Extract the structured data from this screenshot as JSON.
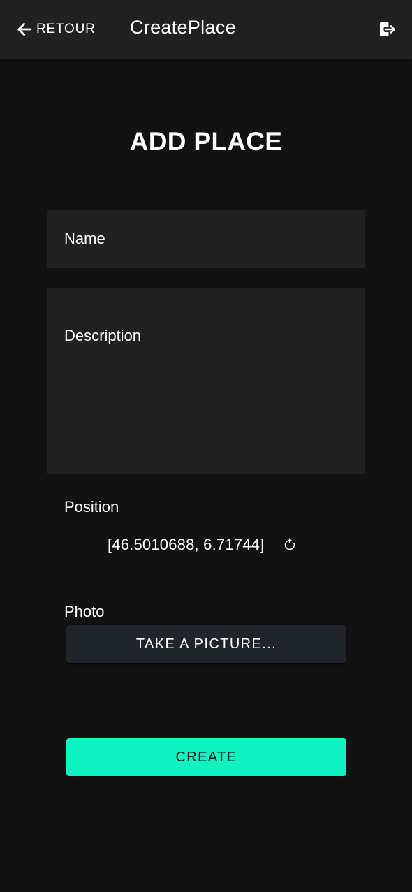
{
  "header": {
    "back_label": "RETOUR",
    "title": "CreatePlace",
    "back_icon": "arrow-left-icon",
    "logout_icon": "logout-icon"
  },
  "page": {
    "title": "ADD PLACE"
  },
  "form": {
    "name_placeholder": "Name",
    "name_value": "",
    "description_placeholder": "Description",
    "description_value": "",
    "position_label": "Position",
    "position_value": "[46.5010688, 6.71744]",
    "refresh_icon": "refresh-icon",
    "photo_label": "Photo",
    "take_picture_label": "TAKE A PICTURE...",
    "create_label": "CREATE"
  },
  "colors": {
    "background": "#121212",
    "header": "#212121",
    "field": "#212121",
    "secondary_button": "#1f252a",
    "accent": "#11f3c1"
  }
}
